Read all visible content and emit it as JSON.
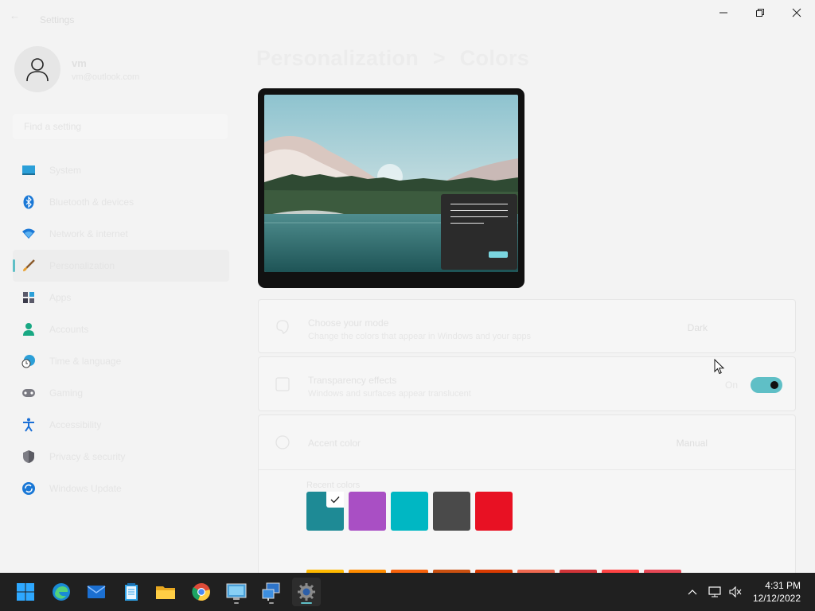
{
  "window": {
    "title": "Settings"
  },
  "profile": {
    "name": "vm",
    "email": "vm@outlook.com"
  },
  "search": {
    "placeholder": "Find a setting"
  },
  "sidebar": {
    "items": [
      {
        "label": "System",
        "icon": "monitor-icon"
      },
      {
        "label": "Bluetooth & devices",
        "icon": "bluetooth-icon"
      },
      {
        "label": "Network & internet",
        "icon": "wifi-icon"
      },
      {
        "label": "Personalization",
        "icon": "brush-icon",
        "selected": true
      },
      {
        "label": "Apps",
        "icon": "apps-icon"
      },
      {
        "label": "Accounts",
        "icon": "person-icon"
      },
      {
        "label": "Time & language",
        "icon": "clock-globe-icon"
      },
      {
        "label": "Gaming",
        "icon": "gamepad-icon"
      },
      {
        "label": "Accessibility",
        "icon": "accessibility-icon"
      },
      {
        "label": "Privacy & security",
        "icon": "shield-icon"
      },
      {
        "label": "Windows Update",
        "icon": "update-icon"
      }
    ]
  },
  "main": {
    "breadcrumb_parent": "Personalization",
    "breadcrumb_sep": ">",
    "breadcrumb_current": "Colors",
    "cards": [
      {
        "title": "Choose your mode",
        "desc": "Change the colors that appear in Windows and your apps",
        "action": "Dark",
        "icon": "palette-icon"
      },
      {
        "title": "Transparency effects",
        "desc": "Windows and surfaces appear translucent",
        "toggle_label": "On",
        "toggle_on": true,
        "icon": "transparency-icon"
      },
      {
        "title": "Accent color",
        "action": "Manual",
        "icon": "accent-icon"
      }
    ],
    "recent_colors_label": "Recent colors",
    "recent_colors": [
      "#1e8a95",
      "#a94fc4",
      "#00b7c3",
      "#4a4a4a",
      "#e81123"
    ],
    "windows_colors_row": [
      "#ffb900",
      "#ff8c00",
      "#f7630c",
      "#ca5010",
      "#da3b01",
      "#ef6950",
      "#d13438",
      "#ff4343",
      "#e74856"
    ]
  },
  "taskbar": {
    "apps": [
      {
        "name": "start-icon"
      },
      {
        "name": "edge-icon"
      },
      {
        "name": "mail-icon"
      },
      {
        "name": "notepad-icon"
      },
      {
        "name": "file-explorer-icon"
      },
      {
        "name": "chrome-icon"
      },
      {
        "name": "remote-desktop-icon",
        "running": true
      },
      {
        "name": "network-tool-icon",
        "running": true
      },
      {
        "name": "settings-icon",
        "active": true
      }
    ],
    "time": "4:31 PM",
    "date": "12/12/2022"
  },
  "colors": {
    "accent": "#5fbfc6",
    "taskbar": "#202020"
  }
}
